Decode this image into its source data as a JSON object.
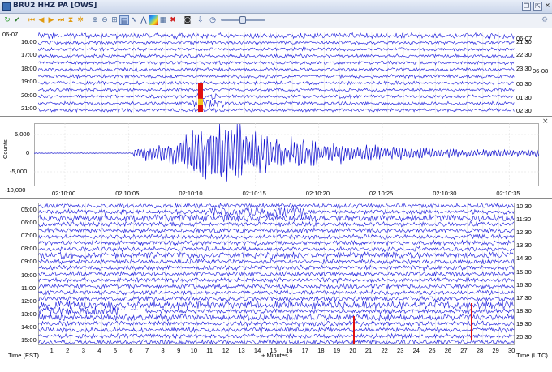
{
  "window": {
    "title": "BRU2 HHZ PA [OWS]"
  },
  "icons": [
    "app-icon",
    "restore-icon",
    "close-icon",
    "detach-icon",
    "toolbar-icons"
  ],
  "top_panel": {
    "date_left": "06-07",
    "dates_right": [
      "06-07",
      "06-08"
    ],
    "left_times": [
      "16:00",
      "17:00",
      "18:00",
      "19:00",
      "20:00",
      "21:00"
    ],
    "right_times": [
      "21:30",
      "22:30",
      "23:30",
      "00:30",
      "01:30",
      "02:30"
    ]
  },
  "waveform_panel": {
    "ylabel": "Counts",
    "yticks": [
      "5,000",
      "0",
      "-5,000",
      "-10,000"
    ],
    "xticks": [
      "02:10:00",
      "02:10:05",
      "02:10:10",
      "02:10:15",
      "02:10:20",
      "02:10:25",
      "02:10:30",
      "02:10:35"
    ]
  },
  "bottom_panel": {
    "left_times": [
      "05:00",
      "06:00",
      "07:00",
      "08:00",
      "09:00",
      "10:00",
      "11:00",
      "12:00",
      "13:00",
      "14:00",
      "15:00"
    ],
    "right_times": [
      "10:30",
      "11:30",
      "12:30",
      "13:30",
      "14:30",
      "15:30",
      "16:30",
      "17:30",
      "18:30",
      "19:30",
      "20:30"
    ],
    "x_minutes": [
      "1",
      "2",
      "3",
      "4",
      "5",
      "6",
      "7",
      "8",
      "9",
      "10",
      "11",
      "12",
      "13",
      "14",
      "15",
      "16",
      "17",
      "18",
      "19",
      "20",
      "21",
      "22",
      "23",
      "24",
      "25",
      "26",
      "27",
      "28",
      "29",
      "30"
    ],
    "left_axis_title": "Time (EST)",
    "center_axis_title": "+ Minutes",
    "right_axis_title": "Time (UTC)"
  },
  "colors": {
    "trace": "#1a1adc",
    "event": "#e01010",
    "grid": "#c8c8c8",
    "wave": "#1010d0"
  }
}
